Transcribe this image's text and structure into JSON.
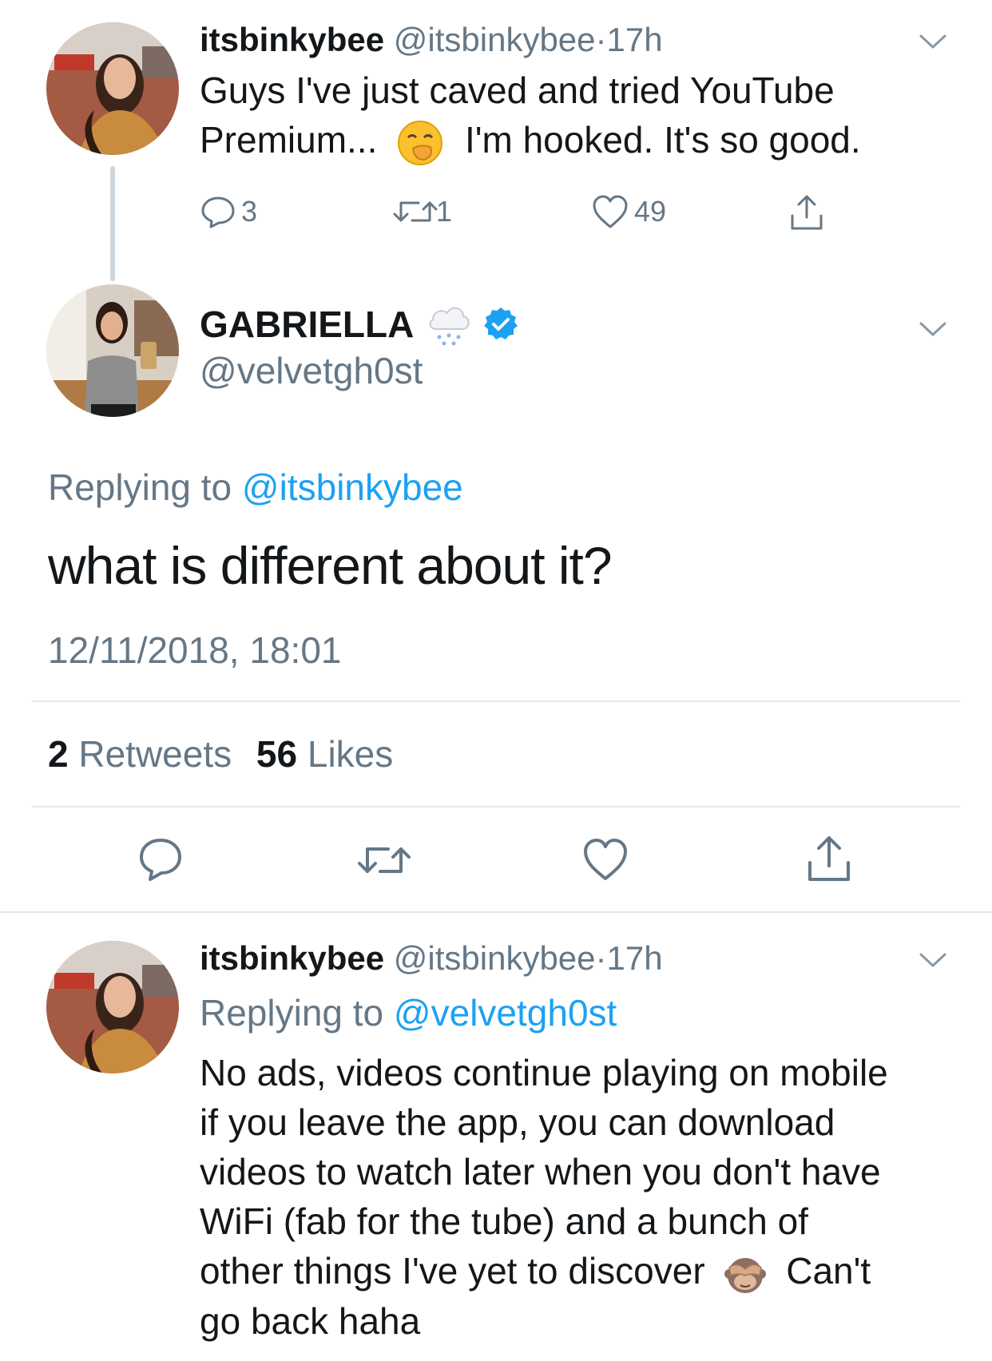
{
  "tweet1": {
    "display_name": "itsbinkybee",
    "handle": "@itsbinkybee",
    "separator": "·",
    "time": "17h",
    "text_line1": "Guys I've just caved and tried YouTube",
    "text_line2a": "Premium...",
    "text_line2b": "I'm hooked. It's so good.",
    "emoji_icon": "face-with-hand-over-mouth-icon",
    "replies": "3",
    "retweets": "1",
    "likes": "49"
  },
  "main_tweet": {
    "display_name": "GABRIELLA",
    "name_emoji_icon": "cloud-with-snow-icon",
    "verified_icon": "verified-badge-icon",
    "handle": "@velvetgh0st",
    "replying_prefix": "Replying to",
    "replying_handle": "@itsbinkybee",
    "text": "what is different about it?",
    "timestamp": "12/11/2018, 18:01",
    "retweets_count": "2",
    "retweets_label": "Retweets",
    "likes_count": "56",
    "likes_label": "Likes"
  },
  "tweet3": {
    "display_name": "itsbinkybee",
    "handle": "@itsbinkybee",
    "separator": "·",
    "time": "17h",
    "replying_prefix": "Replying to",
    "replying_handle": "@velvetgh0st",
    "line1": "No ads, videos continue playing on mobile",
    "line2": "if you leave the app, you can download",
    "line3": "videos to watch later when you don't have",
    "line4": "WiFi (fab for the tube) and a bunch of",
    "line5a": "other things I've yet to discover",
    "line5b": "Can't",
    "line6": "go back haha",
    "emoji_icon": "see-no-evil-monkey-icon"
  },
  "colors": {
    "text": "#14171a",
    "secondary": "#657786",
    "link": "#1da1f2",
    "divider": "#e1e8ed"
  }
}
